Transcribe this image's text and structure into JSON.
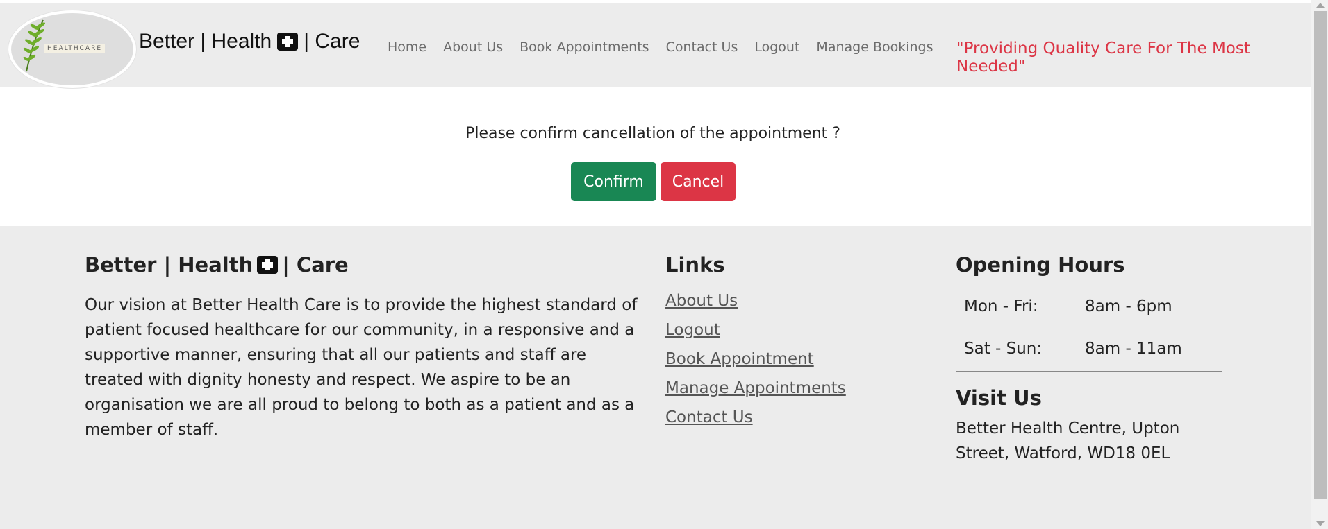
{
  "header": {
    "logo_text": "HEALTHCARE",
    "brand_left": "Better | Health",
    "brand_right": "| Care",
    "brand_icon": "medkit-icon",
    "nav": [
      "Home",
      "About Us",
      "Book Appointments",
      "Contact Us",
      "Logout",
      "Manage Bookings"
    ],
    "tagline": "\"Providing Quality Care For The Most Needed\""
  },
  "confirm": {
    "message": "Please confirm cancellation of the appointment ?",
    "confirm_label": "Confirm",
    "cancel_label": "Cancel"
  },
  "footer": {
    "about": {
      "heading_left": "Better | Health",
      "heading_right": "| Care",
      "vision": "Our vision at Better Health Care is to provide the highest standard of patient focused healthcare for our community, in a responsive and a supportive manner, ensuring that all our patients and staff are treated with dignity honesty and respect. We aspire to be an organisation we are all proud to belong to both as a patient and as a member of staff."
    },
    "links": {
      "heading": "Links",
      "items": [
        "About Us",
        "Logout",
        "Book Appointment",
        "Manage Appointments",
        "Contact Us"
      ]
    },
    "hours": {
      "heading": "Opening Hours",
      "rows": [
        {
          "day": "Mon - Fri:",
          "time": "8am - 6pm"
        },
        {
          "day": "Sat - Sun:",
          "time": "8am - 11am"
        }
      ]
    },
    "visit": {
      "heading": "Visit Us",
      "address": "Better Health Centre, Upton Street, Watford, WD18 0EL"
    }
  },
  "colors": {
    "confirm_green": "#198754",
    "cancel_red": "#dc3545",
    "tagline_red": "#dc3545",
    "header_bg": "#ececec",
    "footer_bg": "#ececec"
  }
}
